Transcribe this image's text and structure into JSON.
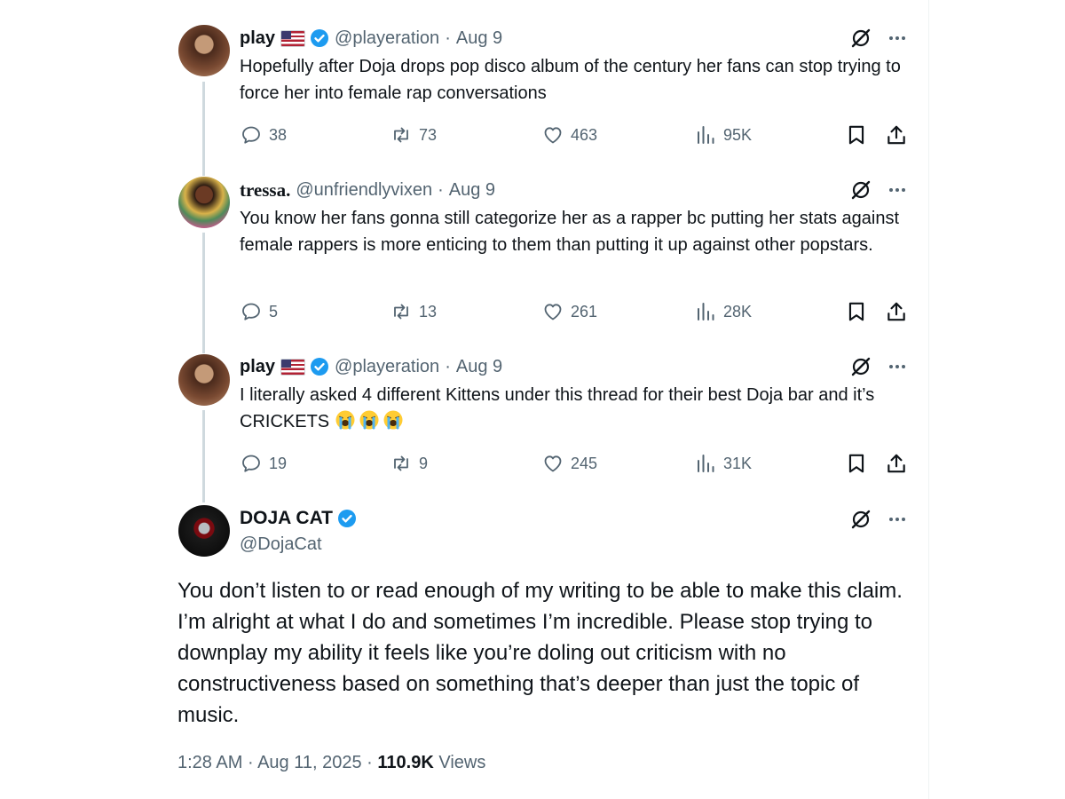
{
  "replies": [
    {
      "name": "play",
      "handle": "@playeration",
      "sep": "·",
      "date": "Aug 9",
      "text": "Hopefully after Doja drops pop disco album of the century her fans can stop trying to force her into female rap conversations",
      "replies": "38",
      "reposts": "73",
      "likes": "463",
      "views": "95K"
    },
    {
      "name": "tressa.",
      "handle": "@unfriendlyvixen",
      "sep": "·",
      "date": "Aug 9",
      "text": "You know her fans gonna still categorize her as a rapper bc putting her stats against female rappers is more enticing to them than  putting it up against other popstars.",
      "replies": "5",
      "reposts": "13",
      "likes": "261",
      "views": "28K"
    },
    {
      "name": "play",
      "handle": "@playeration",
      "sep": "·",
      "date": "Aug 9",
      "text": "I literally asked 4 different Kittens under this thread for their best Doja bar and it’s CRICKETS",
      "emoji": [
        "loudly-crying-face",
        "loudly-crying-face",
        "loudly-crying-face"
      ],
      "replies": "19",
      "reposts": "9",
      "likes": "245",
      "views": "31K"
    }
  ],
  "main_post": {
    "name": "DOJA CAT",
    "handle": "@DojaCat",
    "text": "You don’t listen to or read enough of my writing to be able to make this claim. I’m alright at what I do and sometimes I’m incredible. Please stop trying to downplay my ability it feels like you’re doling out criticism with no constructiveness based on something that’s deeper than just the topic of music.",
    "time": "1:28 AM",
    "sep1": "·",
    "date": "Aug 11, 2025",
    "sep2": "·",
    "views": "110.9K",
    "views_label": "Views"
  },
  "colors": {
    "text": "#0f1419",
    "muted": "#536471",
    "verified": "#1d9bf0",
    "thread_line": "#cfd9de"
  }
}
